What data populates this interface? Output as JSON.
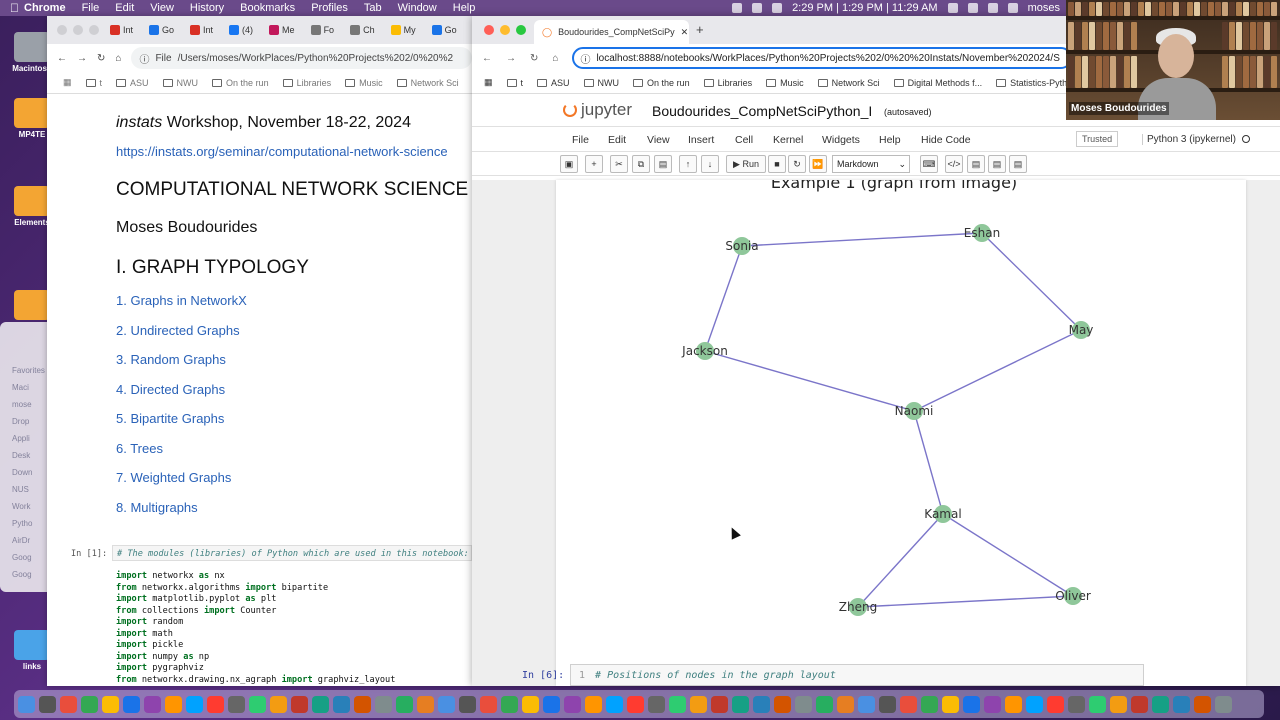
{
  "menubar": {
    "items": [
      "Chrome",
      "File",
      "Edit",
      "View",
      "History",
      "Bookmarks",
      "Profiles",
      "Tab",
      "Window",
      "Help"
    ],
    "clock": "2:29 PM | 1:29 PM | 11:29 AM",
    "user": "moses"
  },
  "desktop": {
    "icons": [
      "Macintosh",
      "MP4TE",
      "Elements",
      "links"
    ]
  },
  "finder": {
    "items": [
      "Favorites",
      "Maci",
      "mose",
      "Drop",
      "Appli",
      "Desk",
      "Down",
      "NUS",
      "Work",
      "Pytho",
      "AirDr",
      "Goog",
      "Goog"
    ]
  },
  "left_window": {
    "tabs": [
      "Int",
      "Go",
      "Int",
      "(4)",
      "Me",
      "Fo",
      "Ch",
      "My",
      "Go"
    ],
    "address_scheme": "File",
    "address": "/Users/moses/WorkPlaces/Python%20Projects%202/0%20%2",
    "bookmarks": [
      "t",
      "ASU",
      "NWU",
      "On the run",
      "Libraries",
      "Music",
      "Network Sci"
    ],
    "doc": {
      "workshop_italic": "instats",
      "workshop_rest": " Workshop, November 18-22, 2024",
      "link": "https://instats.org/seminar/computational-network-science",
      "title": "COMPUTATIONAL NETWORK SCIENCE U",
      "author": "Moses Boudourides",
      "section": "I. GRAPH TYPOLOGY",
      "toc": [
        "1. Graphs in NetworkX",
        "2. Undirected Graphs",
        "3. Random Graphs",
        "4. Directed Graphs",
        "5. Bipartite Graphs",
        "6. Trees",
        "7. Weighted Graphs",
        "8. Multigraphs"
      ]
    },
    "code": {
      "prompt": "In [1]:",
      "comment": "# The modules (libraries) of Python which are used in this notebook:",
      "lines": [
        [
          "import",
          " networkx ",
          "as",
          " nx"
        ],
        [
          "from",
          " networkx.algorithms ",
          "import",
          " bipartite"
        ],
        [
          "import",
          " matplotlib.pyplot ",
          "as",
          " plt"
        ],
        [
          "from",
          " collections ",
          "import",
          " Counter"
        ],
        [
          "import",
          " random",
          "",
          ""
        ],
        [
          "import",
          " math",
          "",
          ""
        ],
        [
          "import",
          " pickle",
          "",
          ""
        ],
        [
          "import",
          " numpy ",
          "as",
          " np"
        ],
        [
          "import",
          " pygraphviz",
          "",
          ""
        ],
        [
          "from",
          " networkx.drawing.nx_agraph ",
          "import",
          " graphviz_layout"
        ]
      ]
    }
  },
  "right_window": {
    "tab_title": "Boudourides_CompNetSciPy",
    "address": "localhost:8888/notebooks/WorkPlaces/Python%20Projects%202/0%20%20Instats/November%202024/S",
    "bookmarks": [
      "t",
      "ASU",
      "NWU",
      "On the run",
      "Libraries",
      "Music",
      "Network Sci",
      "Digital Methods f...",
      "Statistics-Pyth"
    ],
    "jupyter": {
      "logo": "jupyter",
      "notebook": "Boudourides_CompNetSciPython_I",
      "status": "(autosaved)",
      "menu": [
        "File",
        "Edit",
        "View",
        "Insert",
        "Cell",
        "Kernel",
        "Widgets",
        "Help",
        "Hide Code"
      ],
      "trusted": "Trusted",
      "kernel": "Python 3 (ipykernel)",
      "run_label": "Run",
      "cell_type": "Markdown"
    },
    "graph_title": "Example 1 (graph from image)",
    "next_cell": {
      "prompt": "In [6]:",
      "line_no": "1",
      "code": "# Positions of nodes in the graph layout"
    }
  },
  "webcam": {
    "name": "Moses Boudourides"
  },
  "graph": {
    "node_color": "#8fc79a",
    "edge_color": "#7b75c9",
    "nodes": [
      "Sonia",
      "Eshan",
      "May",
      "Jackson",
      "Naomi",
      "Kamal",
      "Zheng",
      "Oliver"
    ],
    "edges": [
      [
        "Sonia",
        "Eshan"
      ],
      [
        "Eshan",
        "May"
      ],
      [
        "Sonia",
        "Jackson"
      ],
      [
        "Jackson",
        "Naomi"
      ],
      [
        "May",
        "Naomi"
      ],
      [
        "Naomi",
        "Kamal"
      ],
      [
        "Kamal",
        "Zheng"
      ],
      [
        "Kamal",
        "Oliver"
      ],
      [
        "Zheng",
        "Oliver"
      ]
    ]
  }
}
